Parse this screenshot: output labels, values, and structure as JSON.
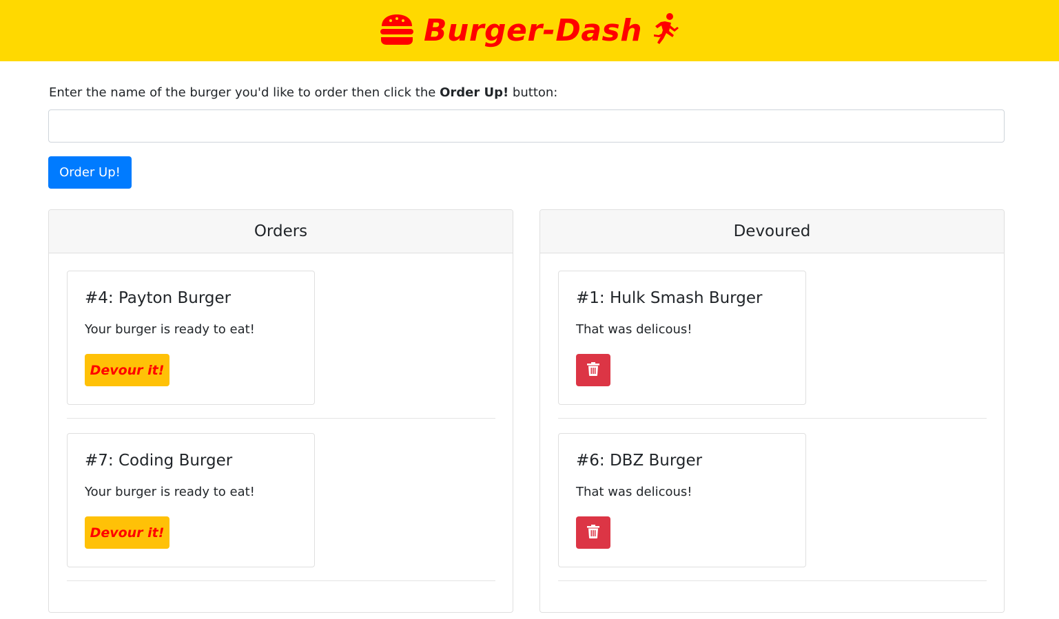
{
  "header": {
    "title": "Burger-Dash",
    "brand_color": "#ff0000",
    "background_color": "#ffd900",
    "left_icon": "burger-icon",
    "right_icon": "running-person-icon"
  },
  "form": {
    "instruction_before": "Enter the name of the burger you'd like to order then click the ",
    "instruction_bold": "Order Up!",
    "instruction_after": " button:",
    "input_value": "",
    "input_placeholder": "",
    "submit_label": "Order Up!",
    "submit_color": "#007bff"
  },
  "orders": {
    "heading": "Orders",
    "items": [
      {
        "title": "#4: Payton Burger",
        "text": "Your burger is ready to eat!",
        "button_label": "Devour it!"
      },
      {
        "title": "#7: Coding Burger",
        "text": "Your burger is ready to eat!",
        "button_label": "Devour it!"
      }
    ],
    "button_color": "#ffc107"
  },
  "devoured": {
    "heading": "Devoured",
    "items": [
      {
        "title": "#1: Hulk Smash Burger",
        "text": "That was delicous!",
        "button_icon": "trash-icon"
      },
      {
        "title": "#6: DBZ Burger",
        "text": "That was delicous!",
        "button_icon": "trash-icon"
      }
    ],
    "button_color": "#dc3545"
  }
}
